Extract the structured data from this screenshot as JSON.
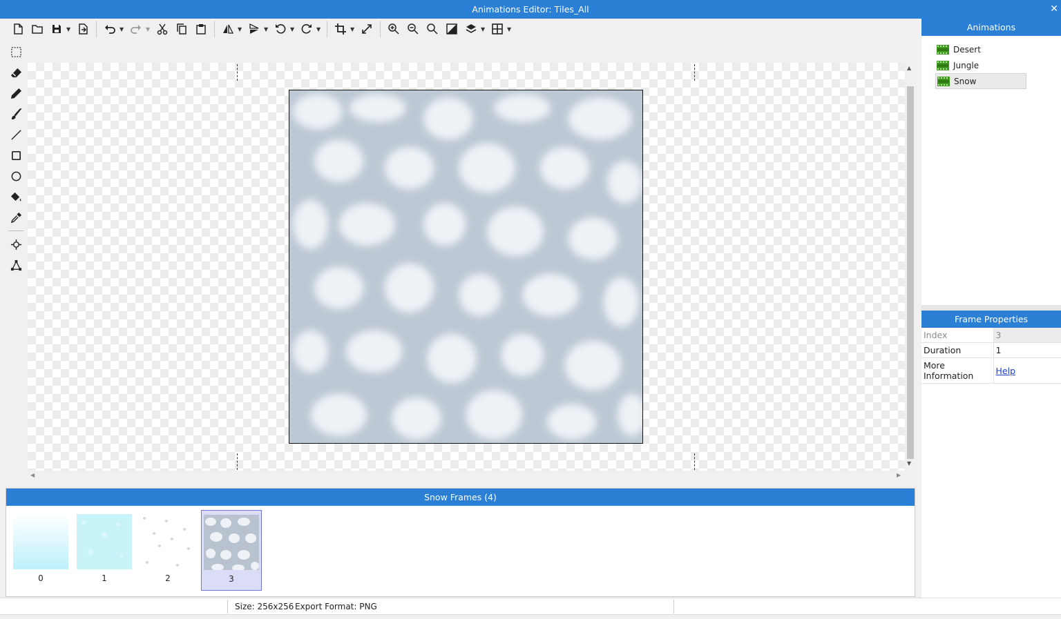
{
  "window": {
    "title": "Animations Editor: Tiles_All",
    "close_glyph": "✕"
  },
  "toolbar": {
    "groups": [
      [
        "new-file-icon",
        "open-folder-icon",
        "save-icon",
        "export-icon"
      ],
      [
        "undo-icon",
        "redo-icon",
        "cut-icon",
        "copy-icon",
        "paste-icon"
      ],
      [
        "flip-horizontal-icon",
        "flip-vertical-icon",
        "rotate-left-icon",
        "rotate-right-icon"
      ],
      [
        "crop-icon",
        "resize-icon"
      ],
      [
        "zoom-in-icon",
        "zoom-out-icon",
        "zoom-reset-icon",
        "contrast-icon",
        "layers-icon",
        "grid-icon"
      ]
    ]
  },
  "tools": [
    "select-rect-icon",
    "eraser-icon",
    "pencil-icon",
    "brush-icon",
    "line-icon",
    "rectangle-icon",
    "ellipse-icon",
    "fill-bucket-icon",
    "eyedropper-icon",
    "origin-point-icon",
    "polygon-icon"
  ],
  "animations": {
    "header": "Animations",
    "items": [
      {
        "label": "Desert",
        "selected": false
      },
      {
        "label": "Jungle",
        "selected": false
      },
      {
        "label": "Snow",
        "selected": true
      }
    ]
  },
  "frame_properties": {
    "header": "Frame Properties",
    "index_label": "Index",
    "index_value": "3",
    "duration_label": "Duration",
    "duration_value": "1",
    "more_label": "More Information",
    "help_link": "Help"
  },
  "frames": {
    "header": "Snow Frames (4)",
    "items": [
      {
        "label": "0",
        "selected": false
      },
      {
        "label": "1",
        "selected": false
      },
      {
        "label": "2",
        "selected": false
      },
      {
        "label": "3",
        "selected": true
      }
    ]
  },
  "status": {
    "size": "Size: 256x256",
    "export": "Export Format: PNG"
  },
  "colors": {
    "accent": "#2b7fd4",
    "selection": "#dadcf8",
    "anim_icon": "#3f9b1f"
  }
}
